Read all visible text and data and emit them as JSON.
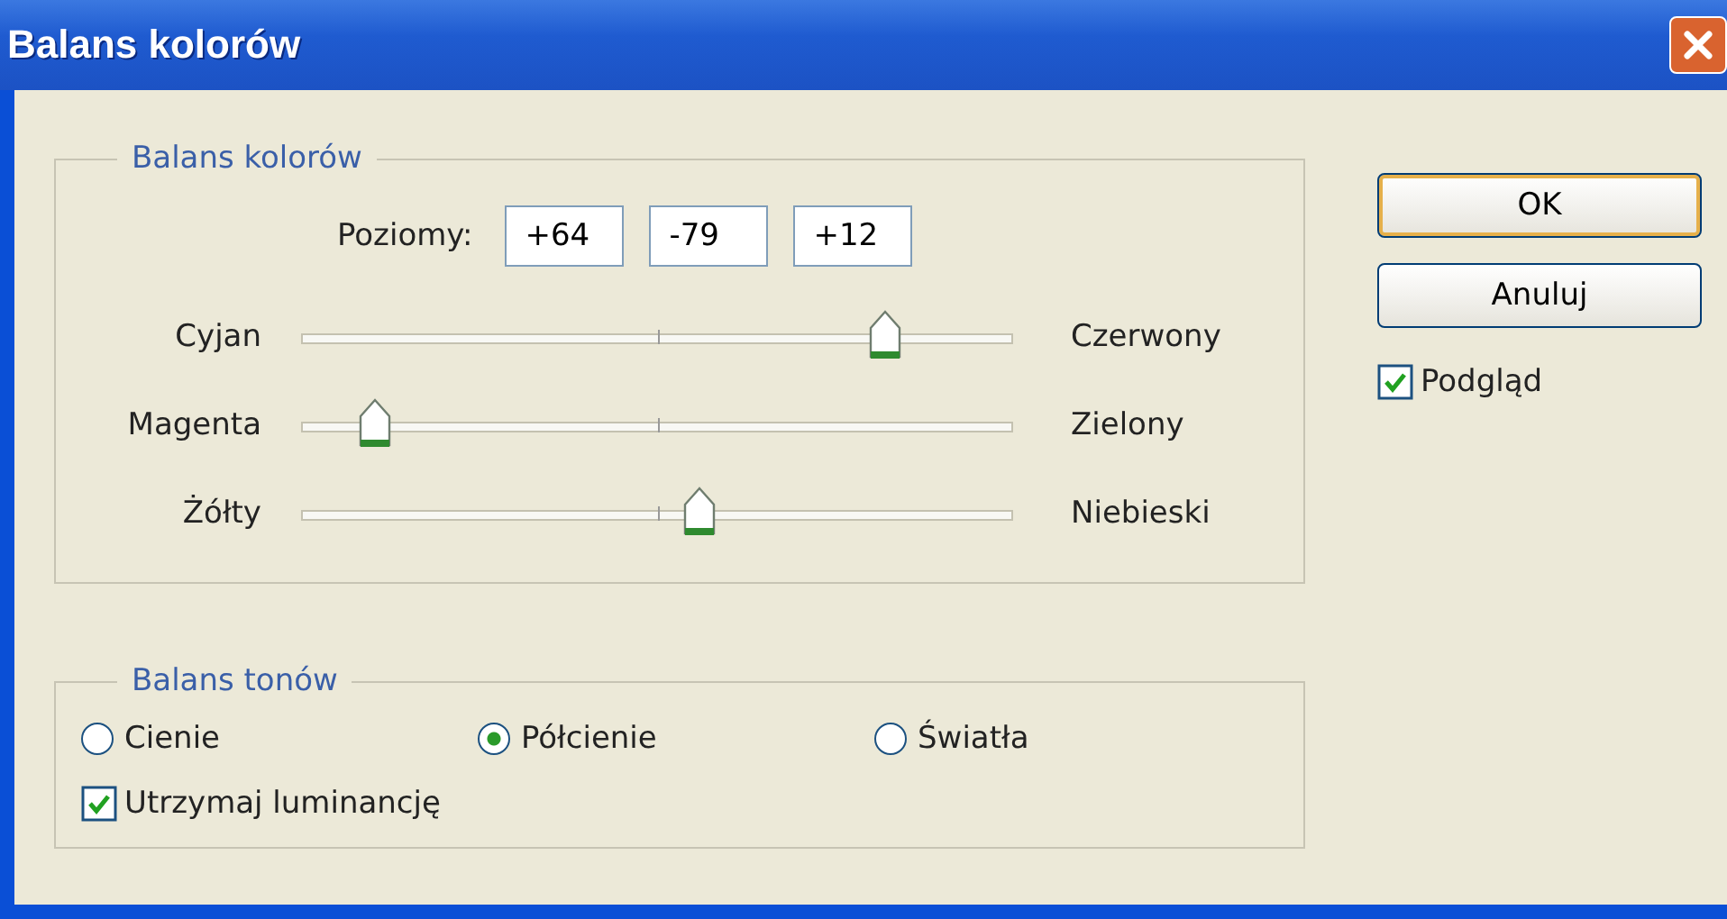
{
  "window": {
    "title": "Balans kolorów"
  },
  "color_balance": {
    "legend": "Balans kolorów",
    "levels_label": "Poziomy:",
    "levels": [
      "+64",
      "-79",
      "+12"
    ],
    "sliders": [
      {
        "left": "Cyjan",
        "right": "Czerwony",
        "level": 0.82
      },
      {
        "left": "Magenta",
        "right": "Zielony",
        "level": 0.105
      },
      {
        "left": "Żółty",
        "right": "Niebieski",
        "level": 0.56
      }
    ]
  },
  "tone_balance": {
    "legend": "Balans tonów",
    "radios": [
      {
        "label": "Cienie",
        "selected": false
      },
      {
        "label": "Półcienie",
        "selected": true
      },
      {
        "label": "Światła",
        "selected": false
      }
    ],
    "preserve_luminosity": {
      "label": "Utrzymaj luminancję",
      "checked": true
    }
  },
  "buttons": [
    {
      "label": "OK",
      "default": true
    },
    {
      "label": "Anuluj",
      "default": false
    }
  ],
  "preview": {
    "label": "Podgląd",
    "checked": true
  }
}
